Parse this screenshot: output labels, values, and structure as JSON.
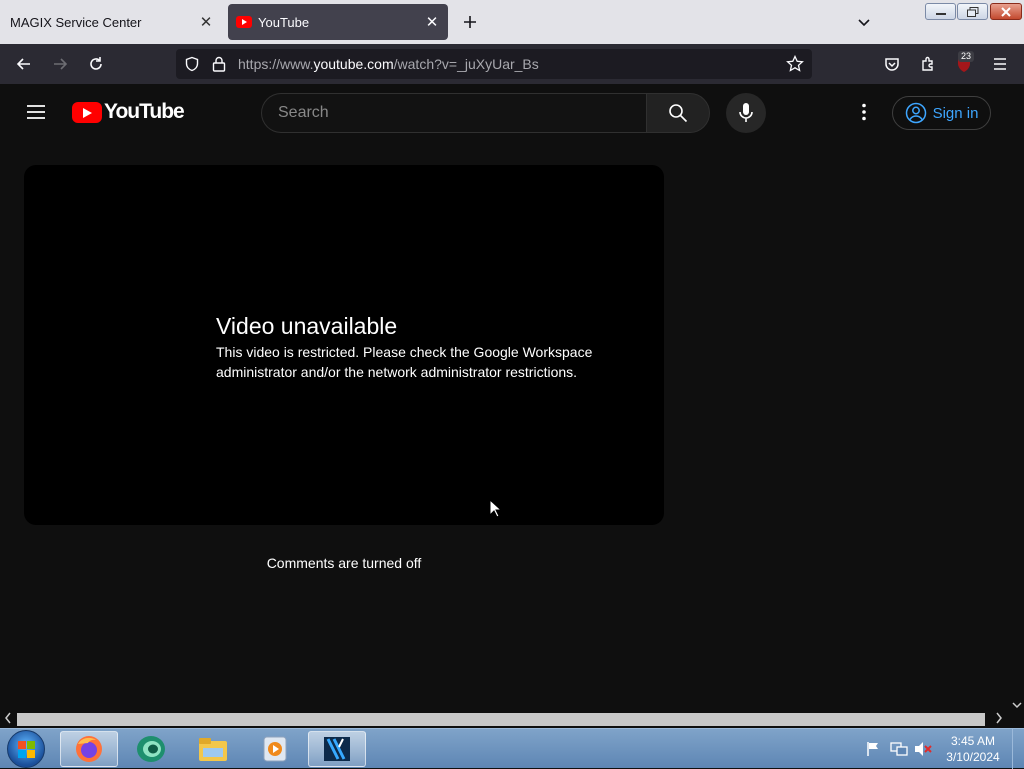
{
  "browser": {
    "tabs": [
      {
        "title": "MAGIX Service Center",
        "active": false
      },
      {
        "title": "YouTube",
        "active": true
      }
    ],
    "url": {
      "scheme": "https://www.",
      "host": "youtube.com",
      "path": "/watch?v=_juXyUar_Bs"
    },
    "extension_badge": "23",
    "window_buttons": {
      "minimize": "▭",
      "restore": "❐",
      "close": "✕"
    }
  },
  "youtube": {
    "logo_text": "YouTube",
    "search": {
      "placeholder": "Search",
      "value": ""
    },
    "sign_in_label": "Sign in",
    "error_title": "Video unavailable",
    "error_message": "This video is restricted. Please check the Google Workspace administrator and/or the network administrator restrictions.",
    "comments_notice": "Comments are turned off"
  },
  "taskbar": {
    "time": "3:45 AM",
    "date": "3/10/2024",
    "apps": [
      "firefox-icon",
      "magix-icon",
      "file-explorer-icon",
      "media-player-icon",
      "video-editor-icon"
    ],
    "active_app": "firefox-icon"
  },
  "colors": {
    "yt_background": "#0f0f0f",
    "yt_red": "#ff0000",
    "sign_in_blue": "#3ea6ff",
    "browser_toolbar": "#2b2a33",
    "tabstrip": "#e3e3e8"
  }
}
